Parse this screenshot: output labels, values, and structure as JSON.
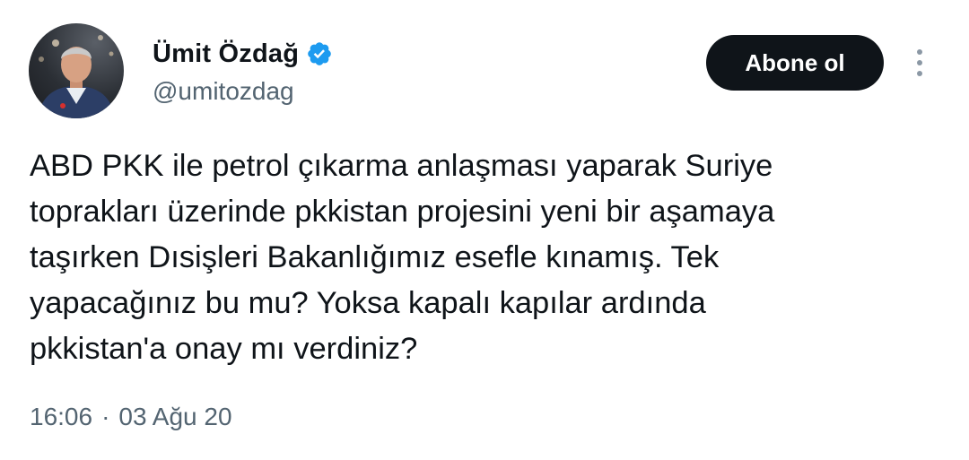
{
  "author": {
    "display_name": "Ümit Özdağ",
    "handle": "@umitozdag",
    "verified": true,
    "verified_badge_color": "#1d9bf0"
  },
  "actions": {
    "follow_label": "Abone ol",
    "more_icon": "more-vertical-icon"
  },
  "tweet": {
    "text": "ABD PKK ile petrol çıkarma anlaşması yaparak Suriye\ntoprakları üzerinde pkkistan projesini yeni bir aşamaya\ntaşırken Dısişleri Bakanlığımız esefle kınamış. Tek\nyapacağınız bu mu? Yoksa kapalı kapılar ardında\npkkistan'a onay mı verdiniz?"
  },
  "meta": {
    "time": "16:06",
    "separator": "·",
    "date": "03 Ağu 20"
  },
  "colors": {
    "text_primary": "#0f1419",
    "text_secondary": "#536471",
    "button_bg": "#0f1419",
    "button_text": "#ffffff"
  }
}
